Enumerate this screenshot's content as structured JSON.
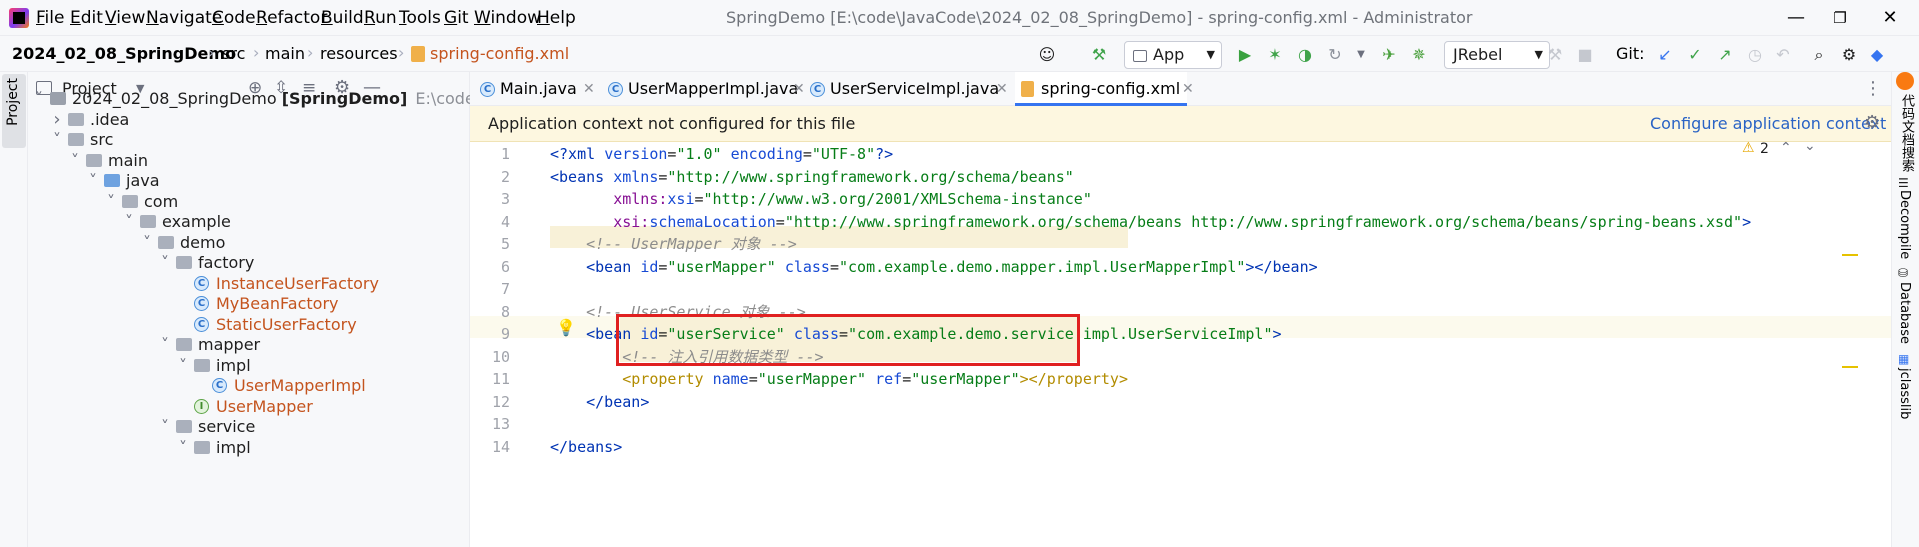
{
  "menu": [
    "File",
    "Edit",
    "View",
    "Navigate",
    "Code",
    "Refactor",
    "Build",
    "Run",
    "Tools",
    "Git",
    "Window",
    "Help"
  ],
  "window_title": "SpringDemo [E:\\code\\JavaCode\\2024_02_08_SpringDemo] - spring-config.xml - Administrator",
  "breadcrumb": [
    "2024_02_08_SpringDemo",
    "src",
    "main",
    "resources",
    "spring-config.xml"
  ],
  "toolbar": {
    "run_config": "App",
    "jrebel": "JRebel",
    "git_label": "Git:"
  },
  "project_panel": {
    "title": "Project",
    "tree": [
      {
        "label": "2024_02_08_SpringDemo",
        "bold": "[SpringDemo]",
        "path": "E:\\code\\Java",
        "depth": 0,
        "arrow": "v",
        "icon": "folder-dot"
      },
      {
        "label": ".idea",
        "depth": 1,
        "arrow": ">",
        "icon": "folder"
      },
      {
        "label": "src",
        "depth": 1,
        "arrow": "v",
        "icon": "folder"
      },
      {
        "label": "main",
        "depth": 2,
        "arrow": "v",
        "icon": "folder"
      },
      {
        "label": "java",
        "depth": 3,
        "arrow": "v",
        "icon": "folder-blue"
      },
      {
        "label": "com",
        "depth": 4,
        "arrow": "v",
        "icon": "folder"
      },
      {
        "label": "example",
        "depth": 5,
        "arrow": "v",
        "icon": "folder"
      },
      {
        "label": "demo",
        "depth": 6,
        "arrow": "v",
        "icon": "folder"
      },
      {
        "label": "factory",
        "depth": 7,
        "arrow": "v",
        "icon": "folder"
      },
      {
        "label": "InstanceUserFactory",
        "depth": 8,
        "arrow": "",
        "icon": "class"
      },
      {
        "label": "MyBeanFactory",
        "depth": 8,
        "arrow": "",
        "icon": "class"
      },
      {
        "label": "StaticUserFactory",
        "depth": 8,
        "arrow": "",
        "icon": "class"
      },
      {
        "label": "mapper",
        "depth": 7,
        "arrow": "v",
        "icon": "folder"
      },
      {
        "label": "impl",
        "depth": 8,
        "arrow": "v",
        "icon": "folder"
      },
      {
        "label": "UserMapperImpl",
        "depth": 9,
        "arrow": "",
        "icon": "class"
      },
      {
        "label": "UserMapper",
        "depth": 8,
        "arrow": "",
        "icon": "interface"
      },
      {
        "label": "service",
        "depth": 7,
        "arrow": "v",
        "icon": "folder"
      },
      {
        "label": "impl",
        "depth": 8,
        "arrow": "v",
        "icon": "folder"
      }
    ]
  },
  "tabs": [
    {
      "label": "Main.java",
      "icon": "C"
    },
    {
      "label": "UserMapperImpl.java",
      "icon": "C"
    },
    {
      "label": "UserServiceImpl.java",
      "icon": "C"
    },
    {
      "label": "spring-config.xml",
      "icon": "xml",
      "active": true
    }
  ],
  "context_banner": {
    "message": "Application context not configured for this file",
    "action": "Configure application context"
  },
  "inspection": {
    "warnings": "2"
  },
  "code_lines": [
    {
      "n": "1",
      "text": "<?xml version=\"1.0\" encoding=\"UTF-8\"?>"
    },
    {
      "n": "2",
      "text": "<beans xmlns=\"http://www.springframework.org/schema/beans\""
    },
    {
      "n": "3",
      "text": "       xmlns:xsi=\"http://www.w3.org/2001/XMLSchema-instance\""
    },
    {
      "n": "4",
      "text": "       xsi:schemaLocation=\"http://www.springframework.org/schema/beans http://www.springframework.org/schema/beans/spring-beans.xsd\">"
    },
    {
      "n": "5",
      "text": "    <!-- UserMapper 对象 -->"
    },
    {
      "n": "6",
      "text": "    <bean id=\"userMapper\" class=\"com.example.demo.mapper.impl.UserMapperImpl\"></bean>"
    },
    {
      "n": "7",
      "text": ""
    },
    {
      "n": "8",
      "text": "    <!-- UserService 对象 -->"
    },
    {
      "n": "9",
      "text": "    <bean id=\"userService\" class=\"com.example.demo.service.impl.UserServiceImpl\">"
    },
    {
      "n": "10",
      "text": "        <!-- 注入引用数据类型 -->"
    },
    {
      "n": "11",
      "text": "        <property name=\"userMapper\" ref=\"userMapper\"></property>"
    },
    {
      "n": "12",
      "text": "    </bean>"
    },
    {
      "n": "13",
      "text": ""
    },
    {
      "n": "14",
      "text": "</beans>"
    }
  ],
  "right_sidebar": [
    "代码文档搜索",
    "Decompile",
    "Database",
    "jclasslib"
  ],
  "colors": {
    "highlight_box": "#e02020",
    "current_line": "#fcfaed",
    "banner": "#fdf7e0"
  }
}
